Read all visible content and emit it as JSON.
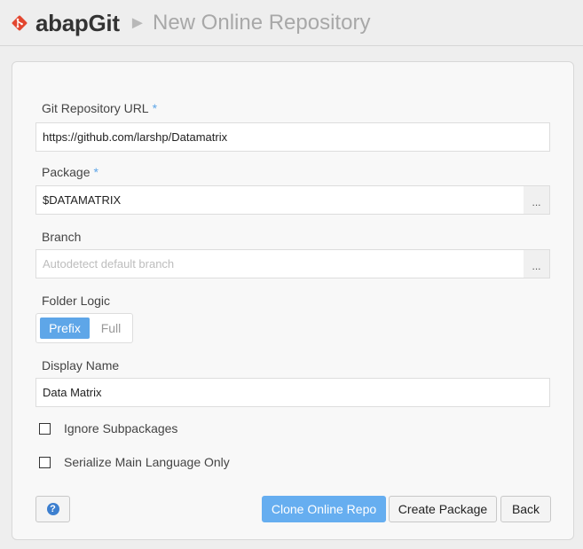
{
  "header": {
    "brand": "abapGit",
    "separator": "►",
    "page_title": "New Online Repository"
  },
  "form": {
    "url": {
      "label": "Git Repository URL",
      "required": "*",
      "value": "https://github.com/larshp/Datamatrix"
    },
    "package": {
      "label": "Package",
      "required": "*",
      "value": "$DATAMATRIX",
      "browse_label": "..."
    },
    "branch": {
      "label": "Branch",
      "value": "",
      "placeholder": "Autodetect default branch",
      "browse_label": "..."
    },
    "folder_logic": {
      "label": "Folder Logic",
      "options": [
        "Prefix",
        "Full"
      ],
      "selected": "Prefix"
    },
    "display_name": {
      "label": "Display Name",
      "value": "Data Matrix"
    },
    "ignore_subpackages": {
      "label": "Ignore Subpackages",
      "checked": false
    },
    "main_language_only": {
      "label": "Serialize Main Language Only",
      "checked": false
    }
  },
  "buttons": {
    "help_icon": "?",
    "clone": "Clone Online Repo",
    "create_package": "Create Package",
    "back": "Back"
  },
  "colors": {
    "accent": "#5ea6e8",
    "primary_button": "#66aef0",
    "logo": "#e2462f"
  },
  "icons": {
    "logo": "git-logo-icon",
    "help": "help-circle-icon"
  }
}
